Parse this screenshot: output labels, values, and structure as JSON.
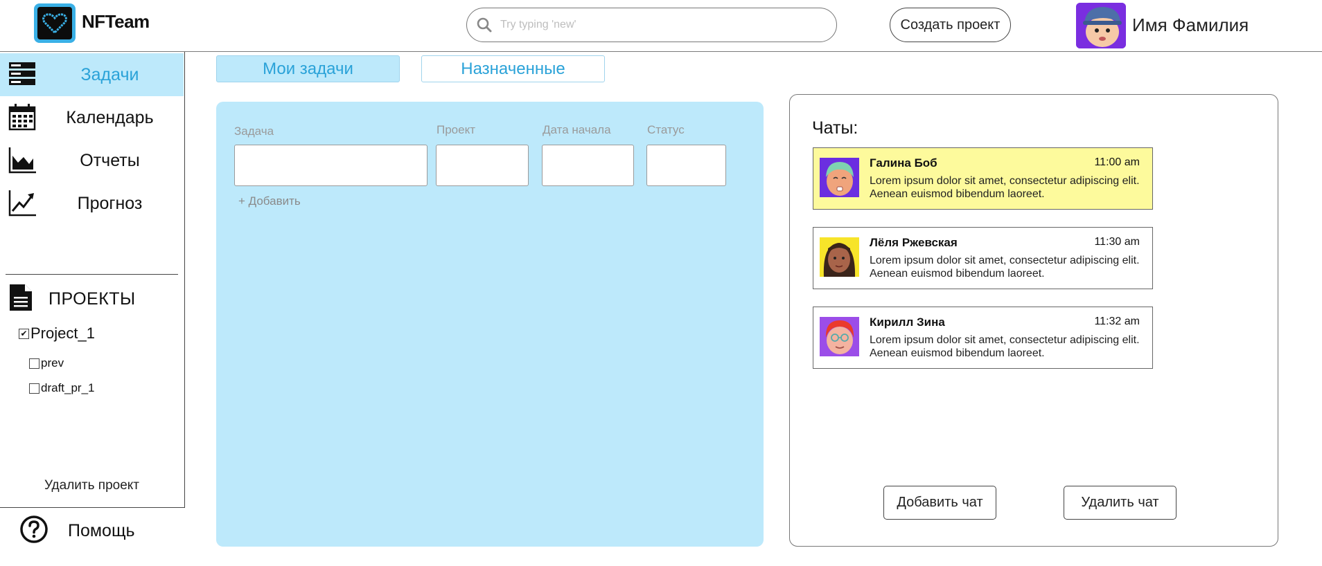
{
  "header": {
    "brand": "NFTeam",
    "search_placeholder": "Try typing 'new'",
    "create_project_label": "Создать проект",
    "user_name": "Имя Фамилия"
  },
  "sidebar": {
    "nav": [
      {
        "label": "Задачи",
        "icon": "tasks-stack-icon",
        "active": true
      },
      {
        "label": "Календарь",
        "icon": "calendar-icon",
        "active": false
      },
      {
        "label": "Отчеты",
        "icon": "area-chart-icon",
        "active": false
      },
      {
        "label": "Прогноз",
        "icon": "trend-chart-icon",
        "active": false
      }
    ],
    "projects_title": "ПРОЕКТЫ",
    "projects": [
      {
        "name": "Project_1",
        "checked": true
      },
      {
        "name": "prev",
        "checked": false
      },
      {
        "name": "draft_pr_1",
        "checked": false
      }
    ],
    "delete_project_label": "Удалить проект",
    "help_label": "Помощь"
  },
  "tabs": [
    {
      "label": "Мои задачи",
      "active": true
    },
    {
      "label": "Назначенные",
      "active": false
    }
  ],
  "tasks_form": {
    "columns": [
      "Задача",
      "Проект",
      "Дата начала",
      "Статус"
    ],
    "add_label": "+ Добавить"
  },
  "chats": {
    "title": "Чаты:",
    "items": [
      {
        "name": "Галина Боб",
        "time": "11:00 am",
        "message": "Lorem ipsum dolor sit amet, consectetur adipiscing elit. Aenean euismod bibendum laoreet.",
        "highlighted": true,
        "avatar_bg": "#6b2ee0"
      },
      {
        "name": "Лёля Ржевская",
        "time": "11:30 am",
        "message": "Lorem ipsum dolor sit amet, consectetur adipiscing elit. Aenean euismod bibendum laoreet.",
        "highlighted": false,
        "avatar_bg": "#f7e42a"
      },
      {
        "name": "Кирилл Зина",
        "time": "11:32 am",
        "message": "Lorem ipsum dolor sit amet, consectetur adipiscing elit. Aenean euismod bibendum laoreet.",
        "highlighted": false,
        "avatar_bg": "#9b4de8"
      }
    ],
    "add_chat_label": "Добавить чат",
    "delete_chat_label": "Удалить чат"
  },
  "colors": {
    "accent_blue": "#2aa2d8",
    "panel_blue": "#bde9fb",
    "highlight_yellow": "#fdfa9c",
    "logo_blue": "#3ab0e6"
  }
}
